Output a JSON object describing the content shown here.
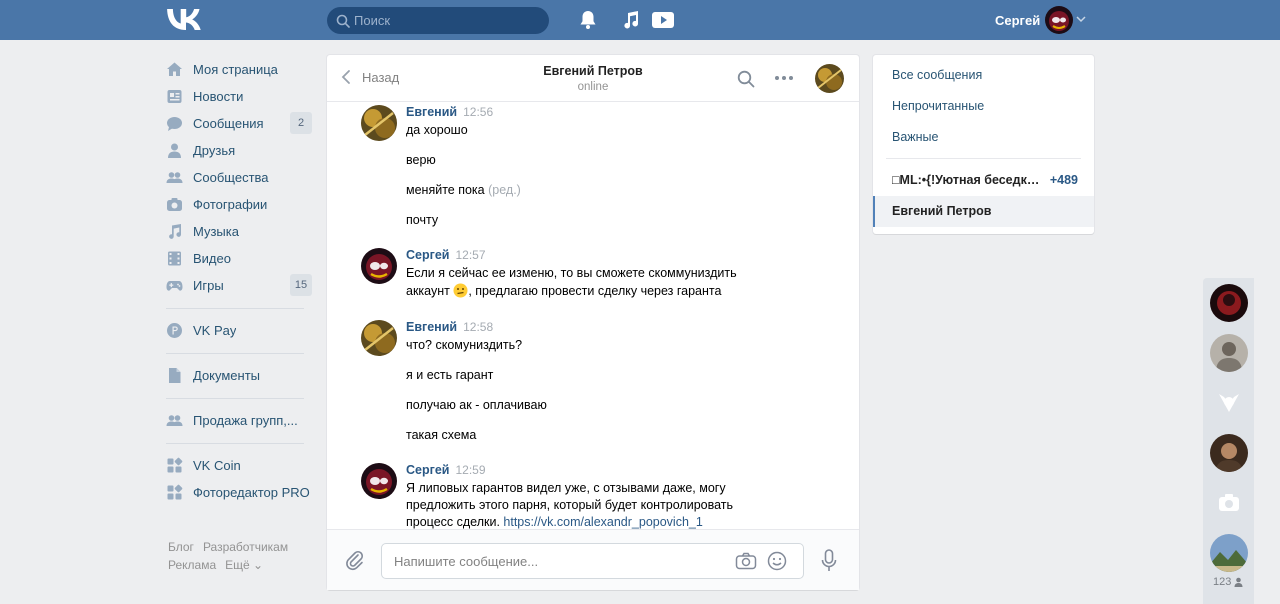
{
  "topbar": {
    "search_placeholder": "Поиск",
    "user_name": "Сергей"
  },
  "nav": {
    "items": [
      {
        "label": "Моя страница",
        "icon": "home-icon"
      },
      {
        "label": "Новости",
        "icon": "news-icon"
      },
      {
        "label": "Сообщения",
        "icon": "messages-icon",
        "badge": "2"
      },
      {
        "label": "Друзья",
        "icon": "friends-icon"
      },
      {
        "label": "Сообщества",
        "icon": "groups-icon"
      },
      {
        "label": "Фотографии",
        "icon": "photos-icon"
      },
      {
        "label": "Музыка",
        "icon": "music-icon"
      },
      {
        "label": "Видео",
        "icon": "video-icon"
      },
      {
        "label": "Игры",
        "icon": "games-icon",
        "badge": "15"
      },
      {
        "label": "VK Pay",
        "icon": "vkpay-icon"
      },
      {
        "label": "Документы",
        "icon": "documents-icon"
      },
      {
        "label": "Продажа групп,...",
        "icon": "group-sale-icon"
      },
      {
        "label": "VK Coin",
        "icon": "app-icon"
      },
      {
        "label": "Фоторедактор PRO",
        "icon": "app-icon"
      }
    ],
    "footer": {
      "blog": "Блог",
      "developers": "Разработчикам",
      "ads": "Реклама",
      "more": "Ещё ⌄"
    }
  },
  "chat": {
    "back_label": "Назад",
    "peer_name": "Евгений Петров",
    "peer_status": "online",
    "composer_placeholder": "Напишите сообщение...",
    "groups": [
      {
        "author": "Евгений",
        "time": "12:56",
        "lines": [
          "да хорошо",
          "верю",
          "меняйте пока",
          "почту"
        ],
        "edited_mark": "(ред.)"
      },
      {
        "author": "Сергей",
        "time": "12:57",
        "lines": [
          "Если я сейчас ее изменю, то вы сможете скоммуниздить",
          "аккаунт",
          ", предлагаю провести сделку через гаранта"
        ]
      },
      {
        "author": "Евгений",
        "time": "12:58",
        "lines": [
          "что? скомуниздить?",
          "я и есть гарант",
          "получаю ак - оплачиваю",
          "такая схема"
        ]
      },
      {
        "author": "Сергей",
        "time": "12:59",
        "lines": [
          "Я липовых гарантов видел уже, с отзывами даже, могу",
          "предложить этого парня, который будет контролировать",
          "процесс сделки. "
        ],
        "link": "https://vk.com/alexandr_popovich_1"
      }
    ]
  },
  "filters": {
    "all": "Все сообщения",
    "unread": "Непрочитанные",
    "important": "Важные",
    "conversations": [
      {
        "name": "□ML:•{!Уютная беседка...",
        "count": "+489"
      },
      {
        "name": "Евгений Петров",
        "count": ""
      }
    ]
  },
  "chatbar": {
    "online_count": "123"
  },
  "colors": {
    "brand": "#4a76a8",
    "link": "#2a5885",
    "background": "#edeef0"
  }
}
